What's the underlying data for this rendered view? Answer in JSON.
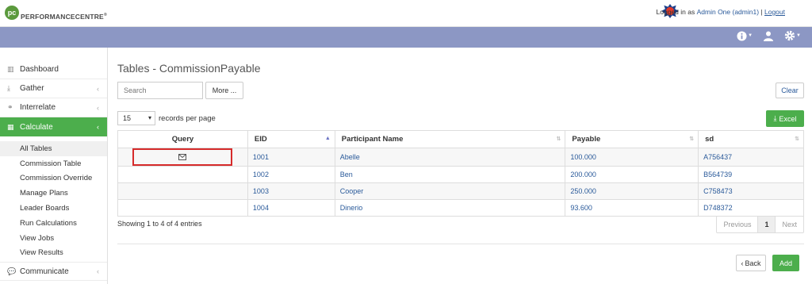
{
  "header": {
    "logo_mark": "pc",
    "logo_text": "PERFORMANCECENTRE",
    "logo_sup": "®",
    "login_prefix": "Logged in as",
    "user": "Admin One (admin1)",
    "separator": "|",
    "logout": "Logout"
  },
  "navbar": {
    "icons": [
      "info-icon",
      "user-icon",
      "gear-icon"
    ]
  },
  "sidebar": {
    "items": [
      {
        "label": "Dashboard",
        "icon": "chart-icon"
      },
      {
        "label": "Gather",
        "icon": "download-icon"
      },
      {
        "label": "Interrelate",
        "icon": "link-icon"
      },
      {
        "label": "Calculate",
        "icon": "table-icon"
      }
    ],
    "sub_items": [
      "All Tables",
      "Commission Table",
      "Commission Override",
      "Manage Plans",
      "Leader Boards",
      "Run Calculations",
      "View Jobs",
      "View Results"
    ],
    "bottom_item": {
      "label": "Communicate",
      "icon": "chat-icon"
    }
  },
  "main": {
    "title": "Tables - CommissionPayable",
    "search_placeholder": "Search",
    "more_label": "More ...",
    "clear_label": "Clear",
    "page_size": "15",
    "records_label": "records per page",
    "excel_label": "Excel",
    "columns": [
      "Query",
      "EID",
      "Participant Name",
      "Payable",
      "sd"
    ],
    "rows": [
      {
        "eid": "1001",
        "name": "Abelle",
        "payable": "100.000",
        "sd": "A756437"
      },
      {
        "eid": "1002",
        "name": "Ben",
        "payable": "200.000",
        "sd": "B564739"
      },
      {
        "eid": "1003",
        "name": "Cooper",
        "payable": "250.000",
        "sd": "C758473"
      },
      {
        "eid": "1004",
        "name": "Dinerio",
        "payable": "93.600",
        "sd": "D748372"
      }
    ],
    "info": "Showing 1 to 4 of 4 entries",
    "pager": {
      "previous": "Previous",
      "current": "1",
      "next": "Next"
    },
    "back_label": "Back",
    "add_label": "Add"
  },
  "colors": {
    "accent_green": "#4cae4c",
    "navbar": "#8c97c4",
    "link": "#2a5a9a",
    "highlight_red": "#d62b2b"
  }
}
